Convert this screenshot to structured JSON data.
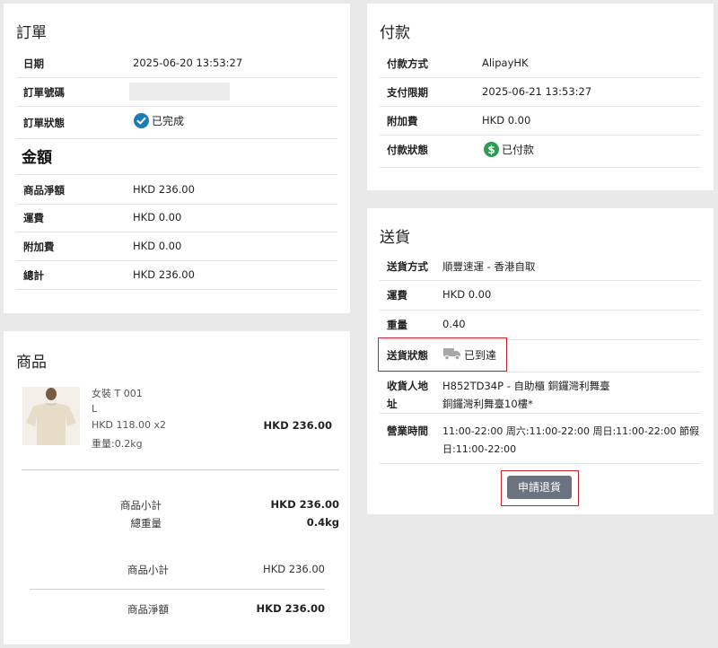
{
  "order": {
    "title": "訂單",
    "rows": [
      {
        "label": "日期",
        "value": "2025-06-20 13:53:27"
      },
      {
        "label": "訂單號碼",
        "value": ""
      },
      {
        "label": "訂單狀態",
        "value": "已完成"
      }
    ],
    "amount_title": "金額",
    "amount_rows": [
      {
        "label": "商品淨額",
        "value": "HKD 236.00"
      },
      {
        "label": "運費",
        "value": "HKD 0.00"
      },
      {
        "label": "附加費",
        "value": "HKD 0.00"
      },
      {
        "label": "總計",
        "value": "HKD 236.00"
      }
    ]
  },
  "payment": {
    "title": "付款",
    "rows": [
      {
        "label": "付款方式",
        "value": "AlipayHK"
      },
      {
        "label": "支付限期",
        "value": "2025-06-21 13:53:27"
      },
      {
        "label": "附加費",
        "value": "HKD 0.00"
      },
      {
        "label": "付款狀態",
        "value": "已付款"
      }
    ]
  },
  "delivery": {
    "title": "送貨",
    "rows": [
      {
        "label": "送貨方式",
        "value": "順豐速運 - 香港自取"
      },
      {
        "label": "運費",
        "value": "HKD 0.00"
      },
      {
        "label": "重量",
        "value": "0.40"
      },
      {
        "label": "送貨狀態",
        "value": "已到達"
      }
    ],
    "address_label_1": "收貨人地",
    "address_label_2": "址",
    "address_line_1": "H852TD34P - 自助櫃 銅鑼灣利舞臺",
    "address_line_2": "銅鑼灣利舞臺10樓*",
    "hours_label": "營業時間",
    "hours_line_1": "11:00-22:00 周六:11:00-22:00 周日:11:00-22:00 節假",
    "hours_line_2": "日:11:00-22:00",
    "return_button": "申請退貨"
  },
  "products": {
    "title": "商品",
    "item": {
      "name": "女裝 T 001",
      "size": "L",
      "price_qty": "HKD 118.00 x2",
      "weight": "重量:0.2kg",
      "total": "HKD 236.00"
    },
    "subtotal_label": "商品小計",
    "subtotal_value": "HKD 236.00",
    "total_weight_label": "總重量",
    "total_weight_value": "0.4kg",
    "subtotal2_label": "商品小計",
    "subtotal2_value": "HKD 236.00",
    "net_label": "商品淨額",
    "net_value": "HKD 236.00"
  },
  "colors": {
    "accent_blue": "#1f7bb6",
    "paid_green": "#2e9b52",
    "highlight_red": "#c8232c",
    "button_gray": "#6b7280"
  }
}
